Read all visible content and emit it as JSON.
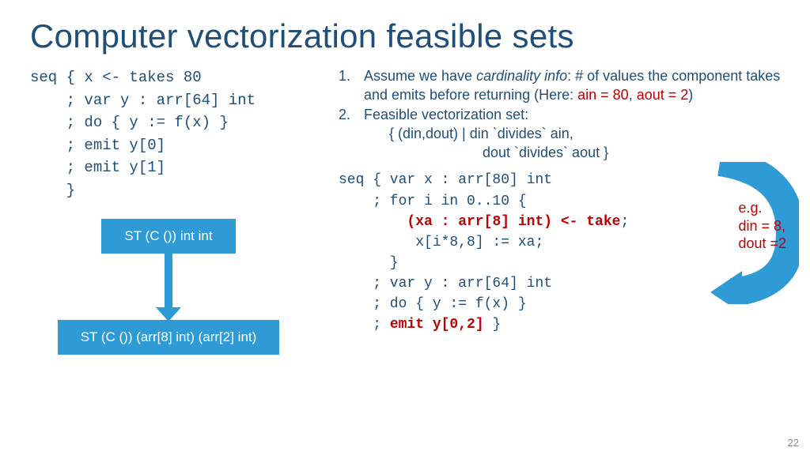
{
  "title": "Computer vectorization feasible sets",
  "page_number": "22",
  "code_left": {
    "l1": "seq { x <- takes 80",
    "l2": "    ; var y : arr[64] int",
    "l3": "    ; do { y := f(x) }",
    "l4": "    ; emit y[0]",
    "l5": "    ; emit y[1]",
    "l6": "    }"
  },
  "flow": {
    "box1": "ST (C ()) int int",
    "box2": "ST (C ()) (arr[8] int) (arr[2] int)"
  },
  "bullets": {
    "n1": "1.",
    "b1a": "Assume we have ",
    "b1b_italic": "cardinality info",
    "b1c": ": # of values the component takes and emits before returning (Here: ",
    "b1d_red": "ain = 80",
    "b1e": ", ",
    "b1f_red": "aout = 2",
    "b1g": ")",
    "n2": "2.",
    "b2a": "Feasible vectorization set:",
    "b2b": "{ (din,dout) | din `divides` ain,",
    "b2c": "dout `divides` aout }"
  },
  "annotation": {
    "l1": "e.g.",
    "l2": "din = 8,",
    "l3": "dout =2"
  },
  "code_right": {
    "l1": "seq { var x : arr[80] int",
    "l2": "    ; for i in 0..10 {",
    "l3a": "        ",
    "l3b_red": "(xa : arr[8] int) <- take",
    "l3c": ";",
    "l4": "         x[i*8,8] := xa;",
    "l5": "      }",
    "l6": "    ; var y : arr[64] int",
    "l7": "    ; do { y := f(x) }",
    "l8a": "    ; ",
    "l8b_red": "emit y[0,2]",
    "l8c": " }"
  }
}
